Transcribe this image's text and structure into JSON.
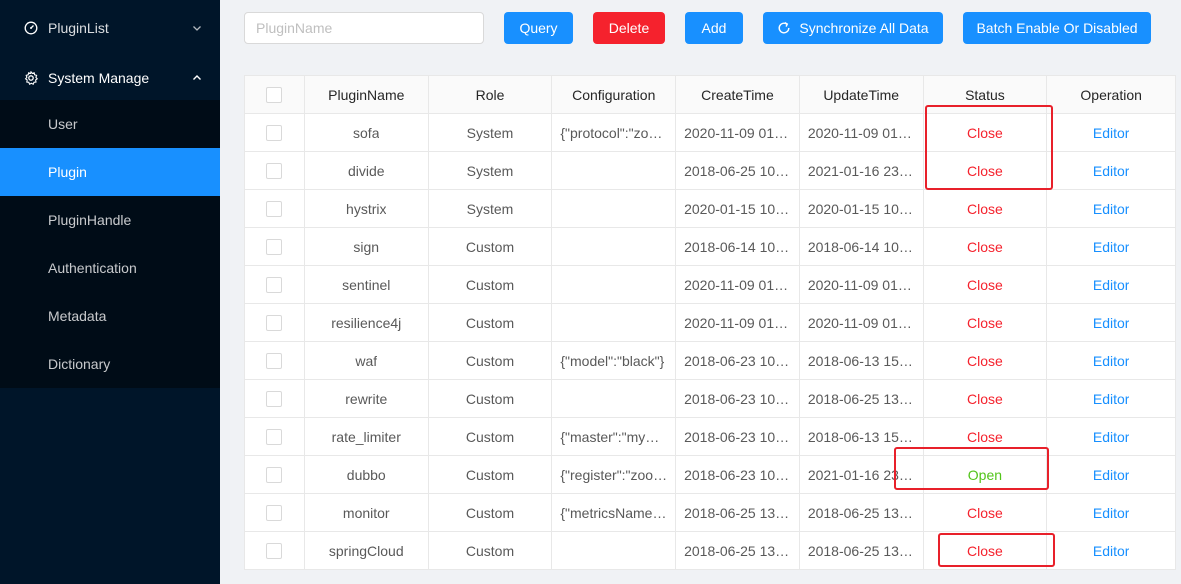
{
  "sidebar": {
    "plugin_list_label": "PluginList",
    "system_manage_label": "System Manage",
    "items": [
      {
        "label": "User",
        "active": false
      },
      {
        "label": "Plugin",
        "active": true
      },
      {
        "label": "PluginHandle",
        "active": false
      },
      {
        "label": "Authentication",
        "active": false
      },
      {
        "label": "Metadata",
        "active": false
      },
      {
        "label": "Dictionary",
        "active": false
      }
    ]
  },
  "toolbar": {
    "search_placeholder": "PluginName",
    "search_value": "",
    "query_label": "Query",
    "delete_label": "Delete",
    "add_label": "Add",
    "sync_label": "Synchronize All Data",
    "batch_label": "Batch Enable Or Disabled"
  },
  "colors": {
    "sidebar_bg": "#001529",
    "submenu_bg": "#000c17",
    "primary": "#1890ff",
    "danger": "#f5222d",
    "success": "#52c41a",
    "annotation": "#e8202a"
  },
  "table": {
    "columns": [
      "PluginName",
      "Role",
      "Configuration",
      "CreateTime",
      "UpdateTime",
      "Status",
      "Operation"
    ],
    "rows": [
      {
        "name": "sofa",
        "role": "System",
        "config": "{\"protocol\":\"zo…",
        "create": "2020-11-09 01:…",
        "update": "2020-11-09 01:…",
        "status": "Close",
        "op": "Editor"
      },
      {
        "name": "divide",
        "role": "System",
        "config": "",
        "create": "2018-06-25 10:…",
        "update": "2021-01-16 23:…",
        "status": "Close",
        "op": "Editor"
      },
      {
        "name": "hystrix",
        "role": "System",
        "config": "",
        "create": "2020-01-15 10:…",
        "update": "2020-01-15 10:…",
        "status": "Close",
        "op": "Editor"
      },
      {
        "name": "sign",
        "role": "Custom",
        "config": "",
        "create": "2018-06-14 10:…",
        "update": "2018-06-14 10:…",
        "status": "Close",
        "op": "Editor"
      },
      {
        "name": "sentinel",
        "role": "Custom",
        "config": "",
        "create": "2020-11-09 01:…",
        "update": "2020-11-09 01:…",
        "status": "Close",
        "op": "Editor"
      },
      {
        "name": "resilience4j",
        "role": "Custom",
        "config": "",
        "create": "2020-11-09 01:…",
        "update": "2020-11-09 01:…",
        "status": "Close",
        "op": "Editor"
      },
      {
        "name": "waf",
        "role": "Custom",
        "config": "{\"model\":\"black\"}",
        "create": "2018-06-23 10:…",
        "update": "2018-06-13 15:…",
        "status": "Close",
        "op": "Editor"
      },
      {
        "name": "rewrite",
        "role": "Custom",
        "config": "",
        "create": "2018-06-23 10:…",
        "update": "2018-06-25 13:…",
        "status": "Close",
        "op": "Editor"
      },
      {
        "name": "rate_limiter",
        "role": "Custom",
        "config": "{\"master\":\"mym…",
        "create": "2018-06-23 10:…",
        "update": "2018-06-13 15:…",
        "status": "Close",
        "op": "Editor"
      },
      {
        "name": "dubbo",
        "role": "Custom",
        "config": "{\"register\":\"zoo…",
        "create": "2018-06-23 10:…",
        "update": "2021-01-16 23:…",
        "status": "Open",
        "op": "Editor"
      },
      {
        "name": "monitor",
        "role": "Custom",
        "config": "{\"metricsName…",
        "create": "2018-06-25 13:…",
        "update": "2018-06-25 13:…",
        "status": "Close",
        "op": "Editor"
      },
      {
        "name": "springCloud",
        "role": "Custom",
        "config": "",
        "create": "2018-06-25 13:…",
        "update": "2018-06-25 13:…",
        "status": "Close",
        "op": "Editor"
      }
    ]
  }
}
